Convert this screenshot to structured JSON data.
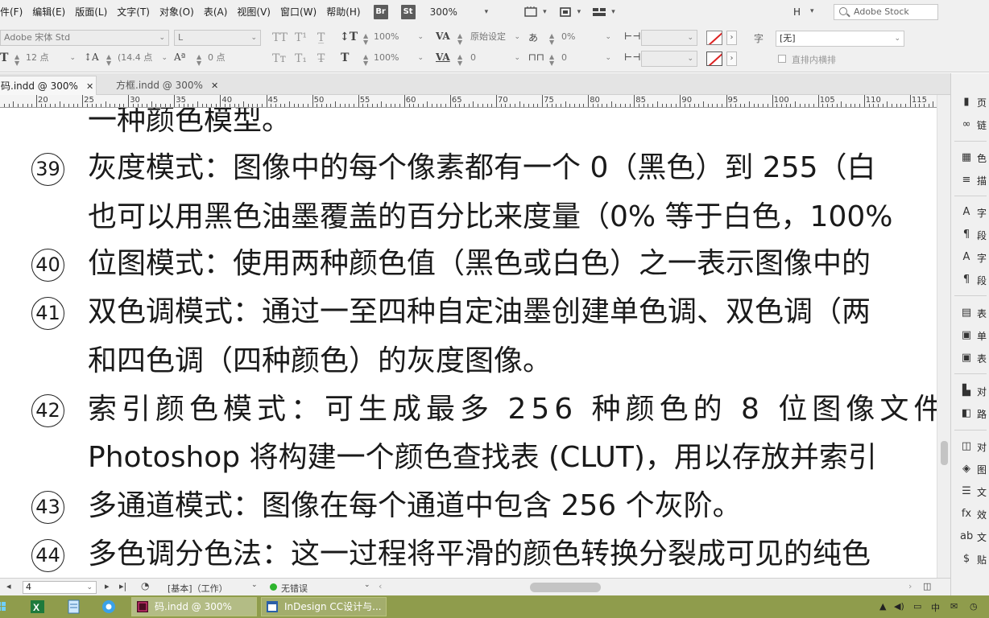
{
  "menubar": {
    "items": [
      "件(F)",
      "编辑(E)",
      "版面(L)",
      "文字(T)",
      "对象(O)",
      "表(A)",
      "视图(V)",
      "窗口(W)",
      "帮助(H)"
    ],
    "bridge_badge": "Br",
    "stock_badge": "St",
    "zoom": "300%",
    "workspace_letter": "H",
    "stock_search_placeholder": "Adobe Stock"
  },
  "controlbar": {
    "font_family": "Adobe 宋体 Std",
    "font_style": "L",
    "font_size": "12 点",
    "leading": "(14.4 点",
    "vertical_scale": "100%",
    "horizontal_scale": "100%",
    "kerning": "原始设定",
    "tracking": "0",
    "baseline_shift": "0 点",
    "tsume": "0%",
    "grid_spacing": "0",
    "char_style_label": "字",
    "char_style": "[无]",
    "vertical_in_horizontal": "直排内横排"
  },
  "tabs": [
    {
      "label": "码.indd @ 300%",
      "active": true
    },
    {
      "label": "方框.indd @ 300%",
      "active": false
    }
  ],
  "ruler": {
    "labels": [
      "20",
      "25",
      "30",
      "35",
      "40",
      "45",
      "50",
      "55",
      "60",
      "65",
      "70",
      "75",
      "80",
      "85",
      "90",
      "95",
      "100",
      "105",
      "110",
      "115"
    ]
  },
  "document": {
    "lines": [
      {
        "number": "",
        "text": "一种颜色模型。",
        "spaced": false
      },
      {
        "number": "39",
        "text": "灰度模式：图像中的每个像素都有一个 0（黑色）到 255（白",
        "spaced": false
      },
      {
        "number": "",
        "text": "也可以用黑色油墨覆盖的百分比来度量（0% 等于白色，100%",
        "spaced": false
      },
      {
        "number": "40",
        "text": "位图模式：使用两种颜色值（黑色或白色）之一表示图像中的",
        "spaced": false
      },
      {
        "number": "41",
        "text": "双色调模式：通过一至四种自定油墨创建单色调、双色调（两",
        "spaced": false
      },
      {
        "number": "",
        "text": "和四色调（四种颜色）的灰度图像。",
        "spaced": false
      },
      {
        "number": "42",
        "text": "索引颜色模式：可生成最多 256 种颜色的 8 位图像文件",
        "spaced": true
      },
      {
        "number": "",
        "text": "Photoshop 将构建一个颜色查找表 (CLUT)，用以存放并索引",
        "spaced": false
      },
      {
        "number": "43",
        "text": "多通道模式：图像在每个通道中包含 256 个灰阶。",
        "spaced": false
      },
      {
        "number": "44",
        "text": "多色调分色法：这一过程将平滑的颜色转换分裂成可见的纯色",
        "spaced": false
      }
    ]
  },
  "rightdock": {
    "items": [
      {
        "icon": "pages-icon",
        "glyph": "▮",
        "label": "页"
      },
      {
        "icon": "links-icon",
        "glyph": "∞",
        "label": "链"
      },
      {
        "icon": "swatches-icon",
        "glyph": "▦",
        "label": "色"
      },
      {
        "icon": "stroke-icon",
        "glyph": "≡",
        "label": "描"
      },
      {
        "icon": "character-icon",
        "glyph": "A",
        "label": "字"
      },
      {
        "icon": "paragraph-icon",
        "glyph": "¶",
        "label": "段"
      },
      {
        "icon": "character-styles-icon",
        "glyph": "A",
        "label": "字"
      },
      {
        "icon": "paragraph-styles-icon",
        "glyph": "¶",
        "label": "段"
      },
      {
        "icon": "table-icon",
        "glyph": "▤",
        "label": "表"
      },
      {
        "icon": "cell-styles-icon",
        "glyph": "▣",
        "label": "单"
      },
      {
        "icon": "table-styles-icon",
        "glyph": "▣",
        "label": "表"
      },
      {
        "icon": "align-icon",
        "glyph": "▙",
        "label": "对"
      },
      {
        "icon": "pathfinder-icon",
        "glyph": "◧",
        "label": "路"
      },
      {
        "icon": "object-styles-icon",
        "glyph": "◫",
        "label": "对"
      },
      {
        "icon": "layers-icon",
        "glyph": "◈",
        "label": "图"
      },
      {
        "icon": "text-wrap-icon",
        "glyph": "☰",
        "label": "文"
      },
      {
        "icon": "effects-icon",
        "glyph": "fx",
        "label": "效"
      },
      {
        "icon": "spelling-icon",
        "glyph": "ab",
        "label": "文"
      },
      {
        "icon": "gradient-icon",
        "glyph": "$",
        "label": "贴"
      }
    ]
  },
  "statusbar": {
    "page": "4",
    "profile": "[基本]（工作）",
    "preflight": "无错误"
  },
  "taskbar": {
    "buttons": [
      "码.indd @ 300%",
      "InDesign CC设计与..."
    ]
  },
  "colors": {
    "accent": "#2db42d",
    "taskbar": "#8f9c4c",
    "none_swatch_line": "#dd2222"
  }
}
